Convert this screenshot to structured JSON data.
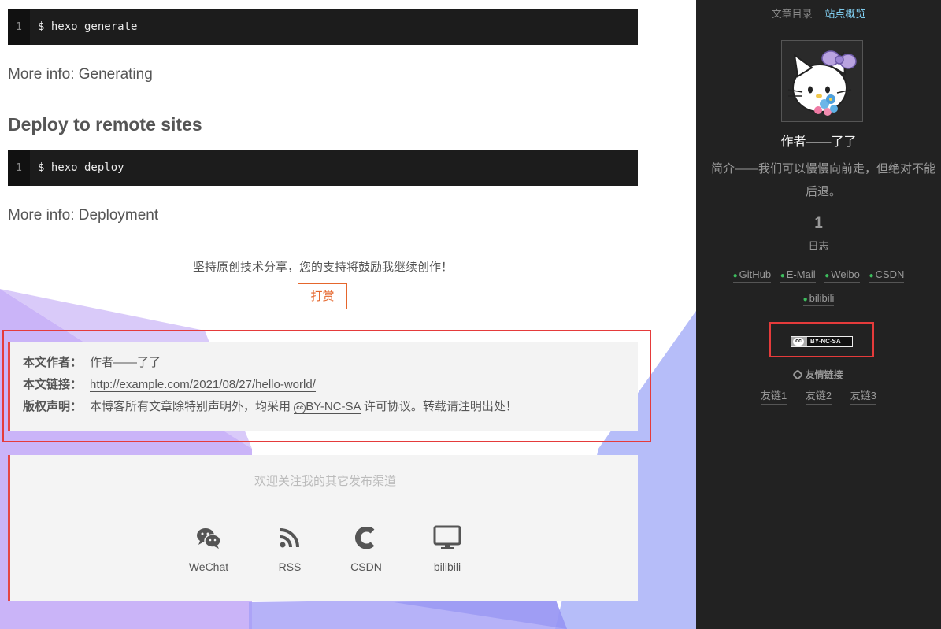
{
  "code_blocks": [
    {
      "line": "1",
      "code": "$ hexo generate"
    },
    {
      "line": "1",
      "code": "$ hexo deploy"
    }
  ],
  "sections": {
    "more_info_label": "More info:",
    "generating_link": "Generating",
    "deploy_heading": "Deploy to remote sites",
    "deployment_link": "Deployment"
  },
  "reward": {
    "text": "坚持原创技术分享，您的支持将鼓励我继续创作！",
    "button": "打赏"
  },
  "copyright": {
    "author_key": "本文作者：",
    "author_value": "作者——了了",
    "link_key": "本文链接：",
    "link_value": "http://example.com/2021/08/27/hello-world/",
    "license_key": "版权声明：",
    "license_prefix": "本博客所有文章除特别声明外，均采用",
    "license_name": "BY-NC-SA",
    "license_suffix": "许可协议。转载请注明出处！"
  },
  "follow": {
    "title": "欢迎关注我的其它发布渠道",
    "items": [
      {
        "label": "WeChat",
        "icon": "wechat-icon"
      },
      {
        "label": "RSS",
        "icon": "rss-icon"
      },
      {
        "label": "CSDN",
        "icon": "csdn-icon"
      },
      {
        "label": "bilibili",
        "icon": "monitor-icon"
      }
    ]
  },
  "sidebar": {
    "tabs": [
      "文章目录",
      "站点概览"
    ],
    "active_tab": "站点概览",
    "author": "作者——了了",
    "description": "简介——我们可以慢慢向前走，但绝对不能后退。",
    "posts_count": "1",
    "posts_label": "日志",
    "social_links": [
      "GitHub",
      "E-Mail",
      "Weibo",
      "CSDN",
      "bilibili"
    ],
    "license_badge": "BY-NC-SA",
    "friends_title": "友情链接",
    "friends": [
      "友链1",
      "友链2",
      "友链3"
    ]
  },
  "colors": {
    "accent_red": "#e53b3b",
    "reward_orange": "#e5662c",
    "tab_active": "#87daff",
    "sidebar_bg": "#222222",
    "social_dot": "#3dbd5d"
  }
}
